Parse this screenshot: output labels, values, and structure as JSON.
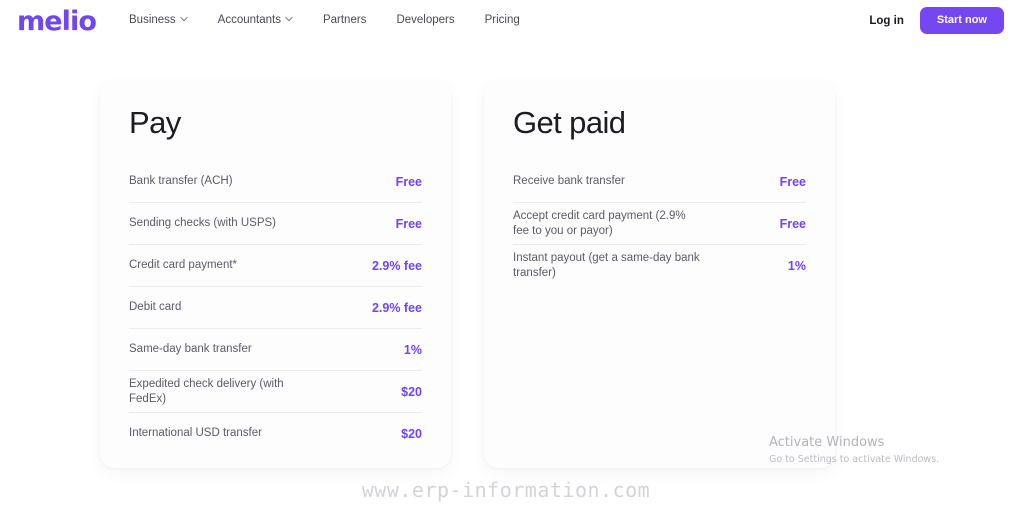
{
  "brand": {
    "logo_text": "melio",
    "accent_color": "#6f46ef",
    "cta_color": "#7547f0"
  },
  "header": {
    "nav_items": [
      {
        "label": "Business",
        "has_dropdown": true,
        "icon": "chevron-down-icon"
      },
      {
        "label": "Accountants",
        "has_dropdown": true,
        "icon": "chevron-down-icon"
      },
      {
        "label": "Partners",
        "has_dropdown": false
      },
      {
        "label": "Developers",
        "has_dropdown": false
      },
      {
        "label": "Pricing",
        "has_dropdown": false
      }
    ],
    "login_label": "Log in",
    "cta_label": "Start now"
  },
  "cards": [
    {
      "title": "Pay",
      "rows": [
        {
          "label": "Bank transfer (ACH)",
          "value": "Free"
        },
        {
          "label": "Sending checks (with USPS)",
          "value": "Free"
        },
        {
          "label": "Credit card payment*",
          "value": "2.9% fee"
        },
        {
          "label": "Debit card",
          "value": "2.9% fee"
        },
        {
          "label": "Same-day bank transfer",
          "value": "1%"
        },
        {
          "label": "Expedited check delivery (with FedEx)",
          "value": "$20"
        },
        {
          "label": "International USD transfer",
          "value": "$20"
        }
      ]
    },
    {
      "title": "Get paid",
      "rows": [
        {
          "label": "Receive bank transfer",
          "value": "Free"
        },
        {
          "label": "Accept credit card payment (2.9% fee to you or payor)",
          "value": "Free"
        },
        {
          "label": "Instant payout (get a same-day bank transfer)",
          "value": "1%"
        }
      ]
    }
  ],
  "watermarks": {
    "windows_activate_title": "Activate Windows",
    "windows_activate_subtitle": "Go to Settings to activate Windows.",
    "site_url": "www.erp-information.com"
  }
}
